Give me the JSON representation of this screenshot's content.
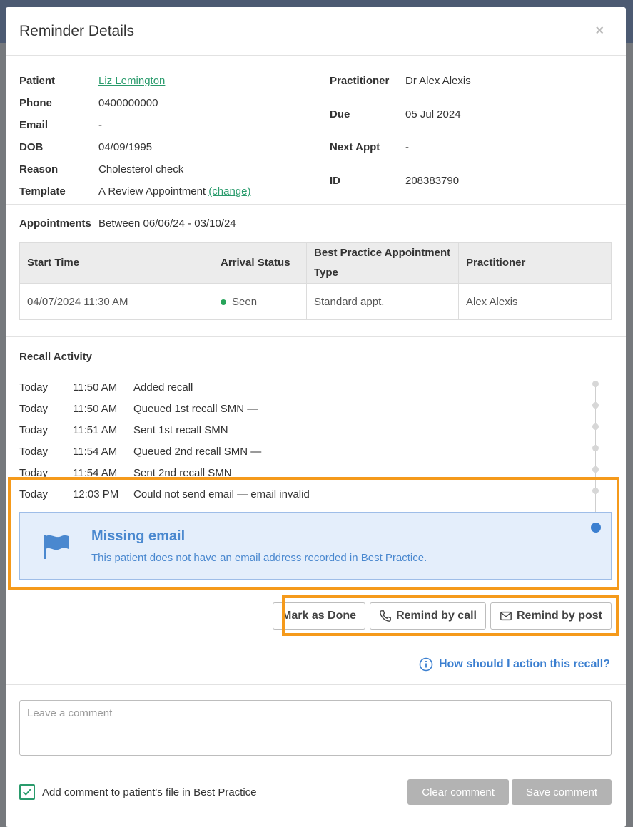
{
  "modal": {
    "title": "Reminder Details",
    "close_label": "×"
  },
  "details": {
    "left": [
      {
        "label": "Patient",
        "value": "Liz Lemington",
        "link": true
      },
      {
        "label": "Phone",
        "value": "0400000000"
      },
      {
        "label": "Email",
        "value": "-"
      },
      {
        "label": "DOB",
        "value": "04/09/1995"
      },
      {
        "label": "Reason",
        "value": "Cholesterol check"
      },
      {
        "label": "Template",
        "value": "A Review Appointment",
        "change_link": "(change)"
      }
    ],
    "right": [
      {
        "label": "Practitioner",
        "value": "Dr Alex Alexis"
      },
      {
        "label": "Due",
        "value": "05 Jul 2024"
      },
      {
        "label": "Next Appt",
        "value": "-"
      },
      {
        "label": "ID",
        "value": "208383790"
      }
    ]
  },
  "appointments": {
    "label": "Appointments",
    "range": "Between 06/06/24 - 03/10/24",
    "columns": [
      "Start Time",
      "Arrival Status",
      "Best Practice Appointment Type",
      "Practitioner"
    ],
    "rows": [
      {
        "start": "04/07/2024 11:30 AM",
        "status": "Seen",
        "status_color": "#27a45a",
        "type": "Standard appt.",
        "practitioner": "Alex Alexis"
      }
    ]
  },
  "recall": {
    "heading": "Recall Activity",
    "activity": [
      {
        "day": "Today",
        "time": "11:50 AM",
        "text": "Added recall"
      },
      {
        "day": "Today",
        "time": "11:50 AM",
        "text": "Queued 1st recall SMN —"
      },
      {
        "day": "Today",
        "time": "11:51 AM",
        "text": "Sent 1st recall SMN"
      },
      {
        "day": "Today",
        "time": "11:54 AM",
        "text": "Queued 2nd recall SMN —"
      },
      {
        "day": "Today",
        "time": "11:54 AM",
        "text": "Sent 2nd recall SMN"
      },
      {
        "day": "Today",
        "time": "12:03 PM",
        "text": "Could not send email — email invalid"
      }
    ],
    "alert": {
      "title": "Missing email",
      "text": "This patient does not have an email address recorded in Best Practice."
    }
  },
  "actions": {
    "mark_done": "Mark as Done",
    "remind_call": "Remind by call",
    "remind_post": "Remind by post"
  },
  "help_link": "How should I action this recall?",
  "comment": {
    "placeholder": "Leave a comment",
    "checkbox_label": "Add comment to patient's file in Best Practice",
    "clear": "Clear comment",
    "save": "Save comment"
  },
  "colors": {
    "highlight": "#f59a1b",
    "link_green": "#2a9b6c",
    "alert_blue": "#4a88cf"
  }
}
